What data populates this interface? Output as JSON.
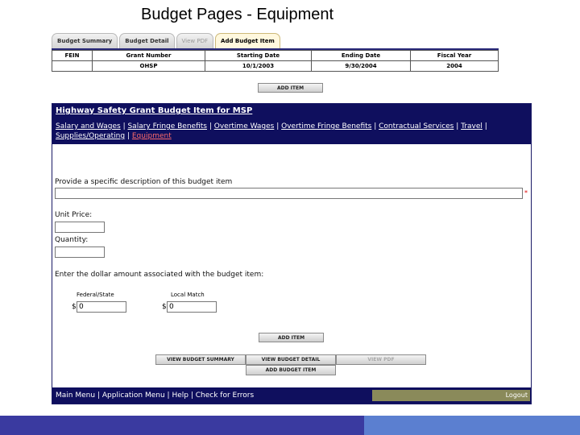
{
  "slide_title": "Budget Pages - Equipment",
  "tabs": [
    "Budget Summary",
    "Budget Detail",
    "View PDF",
    "Add Budget Item"
  ],
  "info_table": {
    "headers": [
      "FEIN",
      "Grant Number",
      "Starting Date",
      "Ending Date",
      "Fiscal Year"
    ],
    "row": [
      "",
      "OHSP",
      "10/1/2003",
      "9/30/2004",
      "2004"
    ]
  },
  "add_item_label": "ADD ITEM",
  "panel": {
    "title": "Highway Safety Grant Budget Item for MSP",
    "categories_line1": [
      "Salary and Wages",
      "Salary Fringe Benefits",
      "Overtime Wages",
      "Overtime Fringe Benefits",
      "Contractual Services",
      "Travel"
    ],
    "categories_line2": [
      "Supplies/Operating",
      "Equipment"
    ],
    "description_label": "Provide a specific description of this budget item",
    "description_value": "",
    "required_mark": "*",
    "unit_price_label": "Unit Price:",
    "unit_price_value": "",
    "quantity_label": "Quantity:",
    "quantity_value": "",
    "dollar_label": "Enter the dollar amount associated with the budget item:",
    "federal_label": "Federal/State",
    "federal_value": "0",
    "local_label": "Local Match",
    "local_value": "0",
    "currency": "$",
    "add_item_label": "ADD ITEM",
    "buttons": {
      "view_summary": "VIEW BUDGET SUMMARY",
      "view_detail": "VIEW BUDGET DETAIL",
      "view_pdf": "VIEW PDF",
      "add_budget_item": "ADD BUDGET ITEM"
    },
    "footer_links": [
      "Main Menu",
      "Application Menu",
      "Help",
      "Check for Errors"
    ],
    "logout": "Logout"
  },
  "colors": {
    "panel_navy": "#0f0f5e",
    "current_link": "#ff6b6b",
    "bar_dark": "#3a3aa0",
    "bar_light": "#5b7fd0"
  }
}
